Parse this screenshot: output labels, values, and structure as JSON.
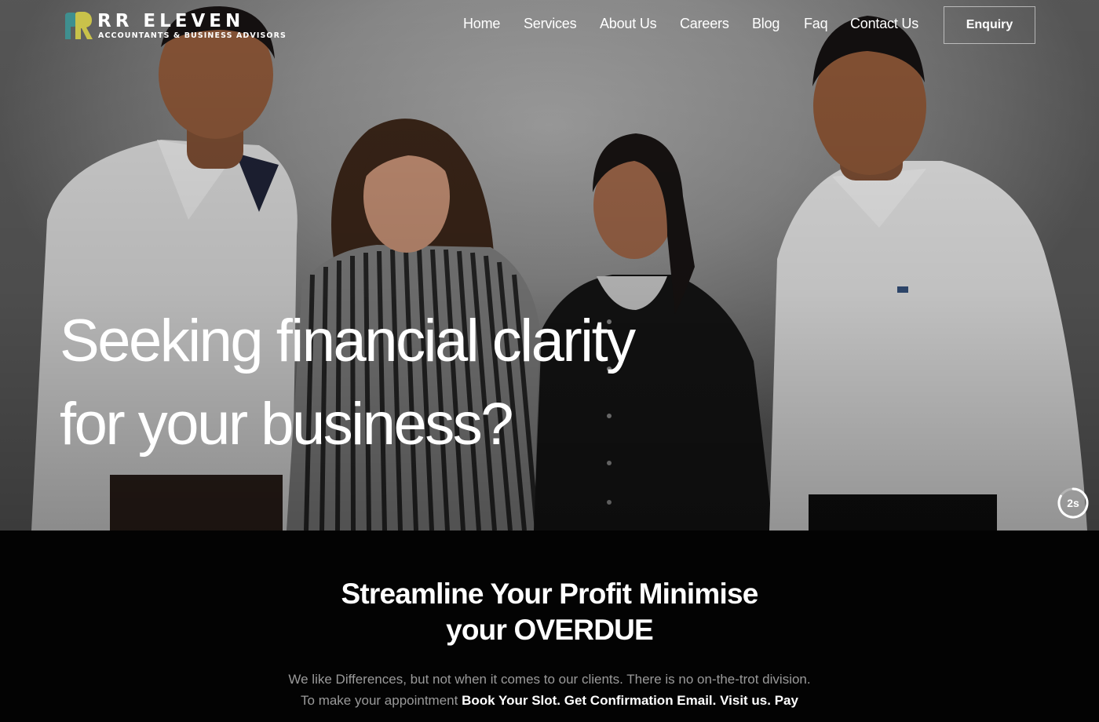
{
  "brand": {
    "name": "RR ELEVEN",
    "tagline": "ACCOUNTANTS & BUSINESS ADVISORS",
    "accent_teal": "#3f8f8f",
    "accent_gold": "#c9c24a"
  },
  "nav": {
    "items": [
      {
        "label": "Home"
      },
      {
        "label": "Services"
      },
      {
        "label": "About Us"
      },
      {
        "label": "Careers"
      },
      {
        "label": "Blog"
      },
      {
        "label": "Faq"
      },
      {
        "label": "Contact Us"
      }
    ],
    "cta_label": "Enquiry"
  },
  "hero": {
    "headline_line1": "Seeking financial clarity",
    "headline_line2": "for your business?",
    "slide_timer": "2s"
  },
  "intro": {
    "title_line1": "Streamline Your Profit Minimise",
    "title_line2": "your OVERDUE",
    "body_line1": "We like Differences, but not when it comes to our clients. There is no on-the-trot division.",
    "body_line2_prefix": "To make your appointment",
    "body_line2_bold": "Book Your Slot. Get Confirmation Email. Visit us. Pay"
  }
}
